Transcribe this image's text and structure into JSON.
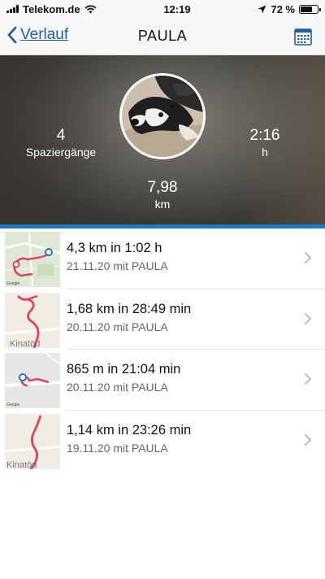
{
  "status_bar": {
    "carrier": "Telekom.de",
    "time": "12:19",
    "battery": "72 %",
    "battery_level": 0.72
  },
  "nav": {
    "back_label": "Verlauf",
    "title": "PAULA",
    "back_icon": "chevron-left-icon",
    "calendar_icon": "calendar-icon"
  },
  "summary": {
    "walks_value": "4",
    "walks_label": "Spaziergänge",
    "time_value": "2:16",
    "time_label": "h",
    "distance_value": "7,98",
    "distance_label": "km"
  },
  "walks": [
    {
      "title": "4,3 km in 1:02 h",
      "subtitle": "21.11.20 mit PAULA",
      "map_label": ""
    },
    {
      "title": "1,68 km in 28:49 min",
      "subtitle": "20.11.20 mit PAULA",
      "map_label": "Kinatöd"
    },
    {
      "title": "865 m in 21:04 min",
      "subtitle": "20.11.20 mit PAULA",
      "map_label": ""
    },
    {
      "title": "1,14 km in 23:26 min",
      "subtitle": "19.11.20 mit PAULA",
      "map_label": "Kinatöd"
    }
  ],
  "colors": {
    "accent": "#1d78c5",
    "link": "#1f5f9e",
    "route": "#d9455f"
  }
}
